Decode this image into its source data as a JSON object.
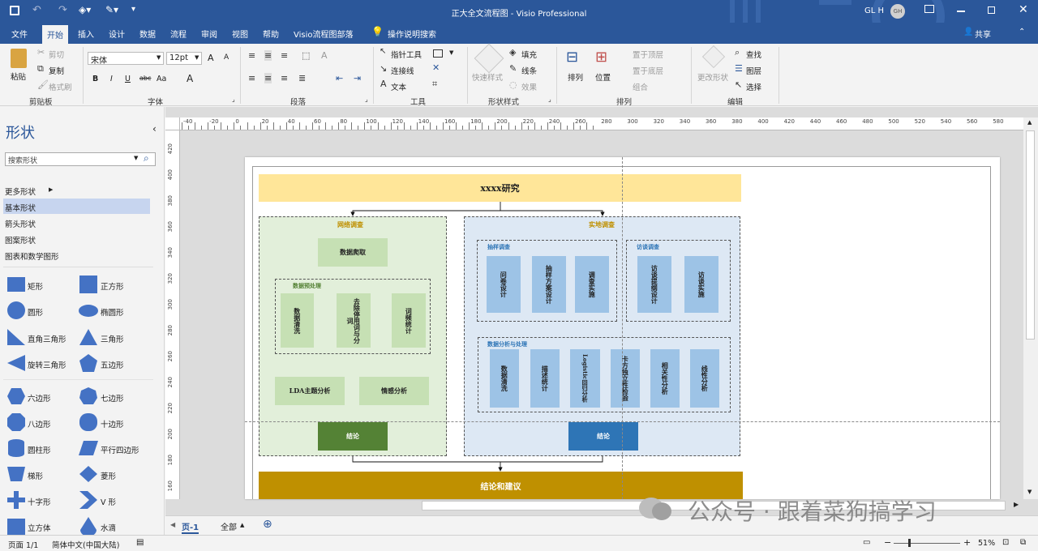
{
  "window": {
    "title": "正大全文流程图 - Visio Professional",
    "user": "GL H",
    "avatar": "GH"
  },
  "tabs": [
    {
      "label": "文件"
    },
    {
      "label": "开始"
    },
    {
      "label": "插入"
    },
    {
      "label": "设计"
    },
    {
      "label": "数据"
    },
    {
      "label": "流程"
    },
    {
      "label": "审阅"
    },
    {
      "label": "视图"
    },
    {
      "label": "帮助"
    },
    {
      "label": "Visio流程图部落"
    },
    {
      "label": "操作说明搜索"
    }
  ],
  "share": "共享",
  "ribbon": {
    "clipboard": {
      "paste": "粘贴",
      "cut": "剪切",
      "copy": "复制",
      "format_painter": "格式刷",
      "group": "剪贴板"
    },
    "font": {
      "name": "宋体",
      "size": "12pt",
      "bold": "B",
      "italic": "I",
      "underline": "U",
      "strike": "abc",
      "case": "Aa",
      "color": "A",
      "grow": "A",
      "shrink": "A",
      "group": "字体"
    },
    "paragraph": {
      "group": "段落"
    },
    "tools": {
      "pointer": "指针工具",
      "connector": "连接线",
      "text": "文本",
      "group": "工具"
    },
    "shape_styles": {
      "quick": "快速样式",
      "fill": "填充",
      "line": "线条",
      "effect": "效果",
      "group": "形状样式"
    },
    "arrange": {
      "align": "排列",
      "position": "位置",
      "front": "置于顶层",
      "back": "置于底层",
      "grouping": "组合",
      "group": "排列"
    },
    "editing": {
      "change_shape": "更改形状",
      "find": "查找",
      "layers": "图层",
      "select": "选择",
      "group": "编辑"
    }
  },
  "shapes_panel": {
    "title": "形状",
    "search_placeholder": "搜索形状",
    "categories": [
      "更多形状",
      "基本形状",
      "箭头形状",
      "图案形状",
      "图表和数学图形"
    ],
    "items": [
      "矩形",
      "正方形",
      "圆形",
      "椭圆形",
      "直角三角形",
      "三角形",
      "旋转三角形",
      "五边形",
      "六边形",
      "七边形",
      "八边形",
      "十边形",
      "圆柱形",
      "平行四边形",
      "梯形",
      "菱形",
      "十字形",
      "V 形",
      "立方体",
      "水滴"
    ]
  },
  "ruler": {
    "h": [
      "-40",
      "-20",
      "0",
      "20",
      "40",
      "60",
      "80",
      "100",
      "120",
      "140",
      "160",
      "180",
      "200",
      "220",
      "240",
      "260",
      "280",
      "300",
      "320",
      "340",
      "360",
      "380",
      "400",
      "420",
      "440",
      "460",
      "480",
      "500",
      "520",
      "540",
      "560",
      "580"
    ],
    "v": [
      "420",
      "400",
      "380",
      "360",
      "340",
      "320",
      "300",
      "280",
      "260",
      "240",
      "220",
      "200",
      "180",
      "160"
    ]
  },
  "diagram": {
    "title": "xxxx研究",
    "online": "网络调查",
    "field": "实地调查",
    "data_crawl": "数据爬取",
    "preprocess": "数据预处理",
    "pre_steps": [
      "数据清洗",
      "去除停用词与分词",
      "词频统计"
    ],
    "lda": "LDA主题分析",
    "sentiment": "情感分析",
    "conclusion_left": "结论",
    "sampling": "抽样调查",
    "sampling_steps": [
      "问卷设计",
      "抽样方案设计",
      "调查实施"
    ],
    "interview": "访谈调查",
    "interview_steps": [
      "访谈提纲设计",
      "访谈实施"
    ],
    "analysis": "数据分析与处理",
    "analysis_steps": [
      "数据清洗",
      "描述统计",
      "Logistic回归分析",
      "卡方独立性检验",
      "相关性分析",
      "线性分析"
    ],
    "conclusion_right": "结论",
    "final": "结论和建议"
  },
  "colors": {
    "title_fill": "#ffe699",
    "online_fill": "#e2efda",
    "green_box": "#c6e0b4",
    "green_dark": "#548235",
    "field_fill": "#dde8f4",
    "blue_box": "#9dc3e6",
    "blue_dark": "#2e75b6",
    "gold": "#bf9000"
  },
  "page_tabs": {
    "page": "页-1",
    "all": "全部"
  },
  "status": {
    "page": "页面 1/1",
    "lang": "简体中文(中国大陆)",
    "zoom": "51%"
  },
  "watermark": "公众号 · 跟着菜狗搞学习"
}
